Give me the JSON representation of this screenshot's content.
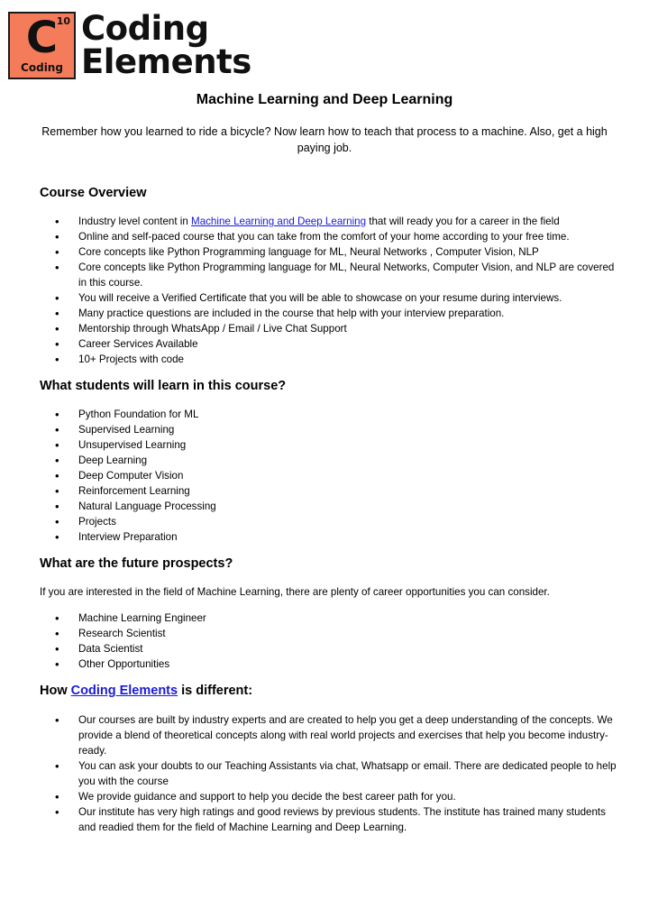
{
  "logo": {
    "element_letter": "C",
    "element_number": "10",
    "element_name": "Coding",
    "wordmark_line1": "Coding",
    "wordmark_line2": "Elements",
    "brand_color": "#f47c5a"
  },
  "title": "Machine Learning and Deep Learning",
  "intro": "Remember how you learned to ride a bicycle? Now learn how to teach that process to a machine. Also, get a high paying job.",
  "overview": {
    "heading": "Course Overview",
    "first_item": {
      "prefix": "Industry level content in ",
      "link": "Machine Learning  and Deep Learning",
      "suffix": "  that will ready you for a career in the field"
    },
    "items": [
      "Online and self-paced course that you can take from the comfort of your home according to your free time.",
      "Core concepts like Python Programming language for ML, Neural Networks , Computer Vision, NLP",
      "Core concepts like Python Programming language for ML, Neural Networks, Computer Vision, and NLP are covered in this course.",
      "You will receive a Verified Certificate that you will be able to showcase on your resume during interviews.",
      "Many practice questions are included in the course that help with your interview preparation.",
      "Mentorship through WhatsApp / Email / Live Chat Support",
      "Career Services Available",
      "10+ Projects with code"
    ]
  },
  "learn": {
    "heading": "What students will learn in this course?",
    "items": [
      "Python Foundation for ML",
      "Supervised Learning",
      "Unsupervised Learning",
      "Deep Learning",
      "Deep Computer Vision",
      "Reinforcement Learning",
      "Natural Language Processing",
      "Projects",
      "Interview Preparation"
    ]
  },
  "prospects": {
    "heading": "What are the future prospects?",
    "paragraph": "If you are interested in the field of Machine Learning, there are plenty of career opportunities you can consider.",
    "items": [
      "Machine Learning Engineer",
      "Research Scientist",
      "Data Scientist",
      "Other Opportunities"
    ]
  },
  "different": {
    "heading_prefix": "How ",
    "heading_link": "Coding Elements",
    "heading_suffix": " is different:",
    "items": [
      "Our courses are built by industry experts and are created to help you get a deep understanding of the concepts. We provide a blend of theoretical concepts along with real world projects and exercises that help you become industry-ready.",
      "You can ask your doubts to our Teaching Assistants via chat, Whatsapp or email. There are dedicated people to help you with the course",
      "We provide guidance and support to help you decide the best career path for you.",
      "Our institute has very high ratings and good reviews by previous students. The institute has trained many students and readied them for the field of Machine Learning and Deep Learning."
    ]
  },
  "link_color": "#1a1adb"
}
